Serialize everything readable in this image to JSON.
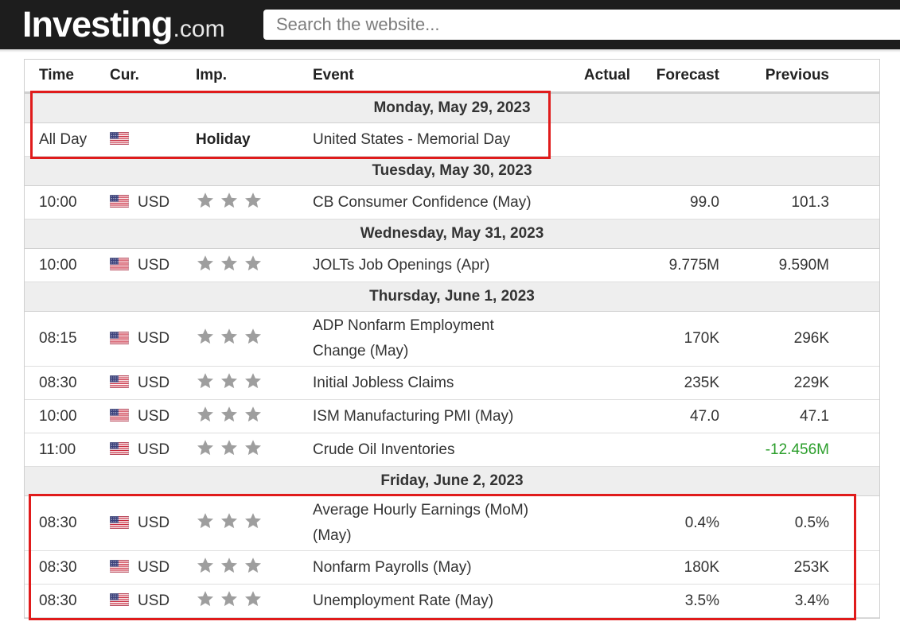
{
  "header": {
    "logo_main": "Investing",
    "logo_suffix": ".com",
    "search_placeholder": "Search the website..."
  },
  "table": {
    "columns": {
      "time": "Time",
      "cur": "Cur.",
      "imp": "Imp.",
      "event": "Event",
      "actual": "Actual",
      "forecast": "Forecast",
      "previous": "Previous"
    },
    "colors": {
      "positive": "#2b9e2b",
      "star": "#9e9e9e",
      "highlight": "#e01b1b"
    },
    "days": [
      {
        "date": "Monday, May 29, 2023",
        "events": [
          {
            "time": "All Day",
            "flag": "us-flag-icon",
            "cur": "",
            "imp": "Holiday",
            "event_lines": [
              "United States - Memorial Day"
            ],
            "actual": "",
            "forecast": "",
            "previous": ""
          }
        ]
      },
      {
        "date": "Tuesday, May 30, 2023",
        "events": [
          {
            "time": "10:00",
            "flag": "us-flag-icon",
            "cur": "USD",
            "stars": 3,
            "event_lines": [
              "CB Consumer Confidence (May)"
            ],
            "actual": "",
            "forecast": "99.0",
            "previous": "101.3"
          }
        ]
      },
      {
        "date": "Wednesday, May 31, 2023",
        "events": [
          {
            "time": "10:00",
            "flag": "us-flag-icon",
            "cur": "USD",
            "stars": 3,
            "event_lines": [
              "JOLTs Job Openings (Apr)"
            ],
            "actual": "",
            "forecast": "9.775M",
            "previous": "9.590M"
          }
        ]
      },
      {
        "date": "Thursday, June 1, 2023",
        "events": [
          {
            "time": "08:15",
            "flag": "us-flag-icon",
            "cur": "USD",
            "stars": 3,
            "event_lines": [
              "ADP Nonfarm Employment",
              "Change (May)"
            ],
            "actual": "",
            "forecast": "170K",
            "previous": "296K"
          },
          {
            "time": "08:30",
            "flag": "us-flag-icon",
            "cur": "USD",
            "stars": 3,
            "event_lines": [
              "Initial Jobless Claims"
            ],
            "actual": "",
            "forecast": "235K",
            "previous": "229K"
          },
          {
            "time": "10:00",
            "flag": "us-flag-icon",
            "cur": "USD",
            "stars": 3,
            "event_lines": [
              "ISM Manufacturing PMI (May)"
            ],
            "actual": "",
            "forecast": "47.0",
            "previous": "47.1"
          },
          {
            "time": "11:00",
            "flag": "us-flag-icon",
            "cur": "USD",
            "stars": 3,
            "event_lines": [
              "Crude Oil Inventories"
            ],
            "actual": "",
            "forecast": "",
            "previous": "-12.456M",
            "previous_positive": true
          }
        ]
      },
      {
        "date": "Friday, June 2, 2023",
        "events": [
          {
            "time": "08:30",
            "flag": "us-flag-icon",
            "cur": "USD",
            "stars": 3,
            "event_lines": [
              "Average Hourly Earnings (MoM)",
              "(May)"
            ],
            "actual": "",
            "forecast": "0.4%",
            "previous": "0.5%"
          },
          {
            "time": "08:30",
            "flag": "us-flag-icon",
            "cur": "USD",
            "stars": 3,
            "event_lines": [
              "Nonfarm Payrolls (May)"
            ],
            "actual": "",
            "forecast": "180K",
            "previous": "253K"
          },
          {
            "time": "08:30",
            "flag": "us-flag-icon",
            "cur": "USD",
            "stars": 3,
            "event_lines": [
              "Unemployment Rate (May)"
            ],
            "actual": "",
            "forecast": "3.5%",
            "previous": "3.4%"
          }
        ]
      }
    ]
  }
}
